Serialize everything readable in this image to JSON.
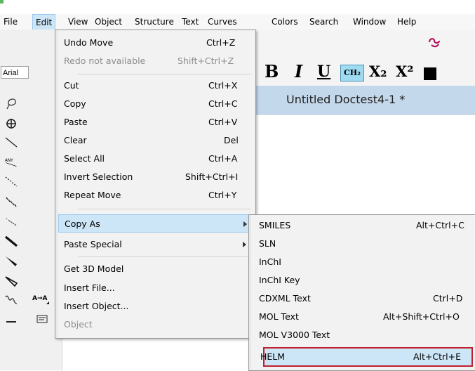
{
  "menubar": {
    "items": [
      {
        "label": "File"
      },
      {
        "label": "Edit"
      },
      {
        "label": "View"
      },
      {
        "label": "Object"
      },
      {
        "label": "Structure"
      },
      {
        "label": "Text"
      },
      {
        "label": "Curves"
      },
      {
        "label": "Colors"
      },
      {
        "label": "Search"
      },
      {
        "label": "Window"
      },
      {
        "label": "Help"
      }
    ]
  },
  "font_field": {
    "value": "Arial"
  },
  "format_toolbar": {
    "bold": "B",
    "italic": "I",
    "underline": "U",
    "chem_style": "CH₂",
    "subscript": "X₂",
    "superscript": "X²"
  },
  "left_tools": {
    "any_label": "ANY",
    "a_to_a_label": "A→A"
  },
  "document": {
    "title": "Untitled Doctest4-1 *"
  },
  "edit_menu": {
    "items": [
      {
        "label": "Undo Move",
        "shortcut": "Ctrl+Z"
      },
      {
        "label": "Redo not available",
        "shortcut": "Shift+Ctrl+Z"
      },
      {
        "label": "Cut",
        "shortcut": "Ctrl+X"
      },
      {
        "label": "Copy",
        "shortcut": "Ctrl+C"
      },
      {
        "label": "Paste",
        "shortcut": "Ctrl+V"
      },
      {
        "label": "Clear",
        "shortcut": "Del"
      },
      {
        "label": "Select All",
        "shortcut": "Ctrl+A"
      },
      {
        "label": "Invert Selection",
        "shortcut": "Shift+Ctrl+I"
      },
      {
        "label": "Repeat Move",
        "shortcut": "Ctrl+Y"
      },
      {
        "label": "Copy As",
        "shortcut": ""
      },
      {
        "label": "Paste Special",
        "shortcut": ""
      },
      {
        "label": "Get 3D Model",
        "shortcut": ""
      },
      {
        "label": "Insert File...",
        "shortcut": ""
      },
      {
        "label": "Insert Object...",
        "shortcut": ""
      },
      {
        "label": "Object",
        "shortcut": ""
      }
    ]
  },
  "copy_as_submenu": {
    "items": [
      {
        "label": "SMILES",
        "shortcut": "Alt+Ctrl+C"
      },
      {
        "label": "SLN",
        "shortcut": ""
      },
      {
        "label": "InChI",
        "shortcut": ""
      },
      {
        "label": "InChI Key",
        "shortcut": ""
      },
      {
        "label": "CDXML Text",
        "shortcut": "Ctrl+D"
      },
      {
        "label": "MOL Text",
        "shortcut": "Alt+Shift+Ctrl+O"
      },
      {
        "label": "MOL V3000 Text",
        "shortcut": ""
      },
      {
        "label": "HELM",
        "shortcut": "Alt+Ctrl+E"
      }
    ]
  },
  "colors": {
    "highlight": "#cde6f7",
    "highlight_border": "#99c9ef",
    "outline_red": "#c0202b",
    "doc_title_bg": "#c4d8ec",
    "logo_magenta": "#b3125f"
  }
}
